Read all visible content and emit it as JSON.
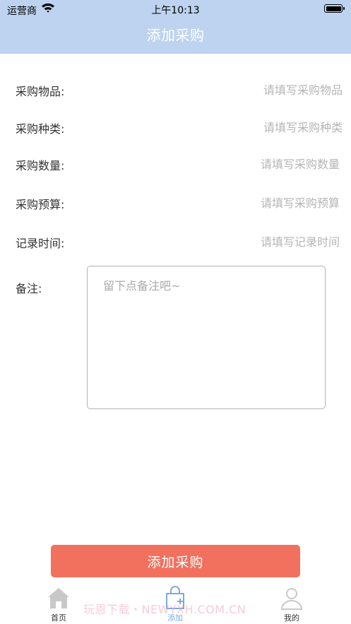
{
  "status_bar": {
    "carrier": "运营商",
    "time": "上午10:13"
  },
  "nav": {
    "title": "添加采购"
  },
  "form": {
    "fields": [
      {
        "label": "采购物品:",
        "placeholder": "请填写采购物品"
      },
      {
        "label": "采购种类:",
        "placeholder": "请填写采购种类"
      },
      {
        "label": "采购数量:",
        "placeholder": "请填写采购数量"
      },
      {
        "label": "采购预算:",
        "placeholder": "请填写采购预算"
      },
      {
        "label": "记录时间:",
        "placeholder": "请填写记录时间"
      }
    ],
    "notes": {
      "label": "备注:",
      "placeholder": "留下点备注吧~"
    },
    "submit_label": "添加采购"
  },
  "tabs": [
    {
      "label": "首页",
      "icon": "home-icon",
      "active": false
    },
    {
      "label": "添加",
      "icon": "add-bag-icon",
      "active": true
    },
    {
      "label": "我的",
      "icon": "user-icon",
      "active": false
    }
  ],
  "watermark": "玩恩下载・NEWYXH.COM.CN",
  "colors": {
    "header_bg": "#bdd3ef",
    "accent_button": "#f1715e",
    "active_tab": "#7ea9db",
    "inactive_tab_icon": "#c8c8c8"
  }
}
